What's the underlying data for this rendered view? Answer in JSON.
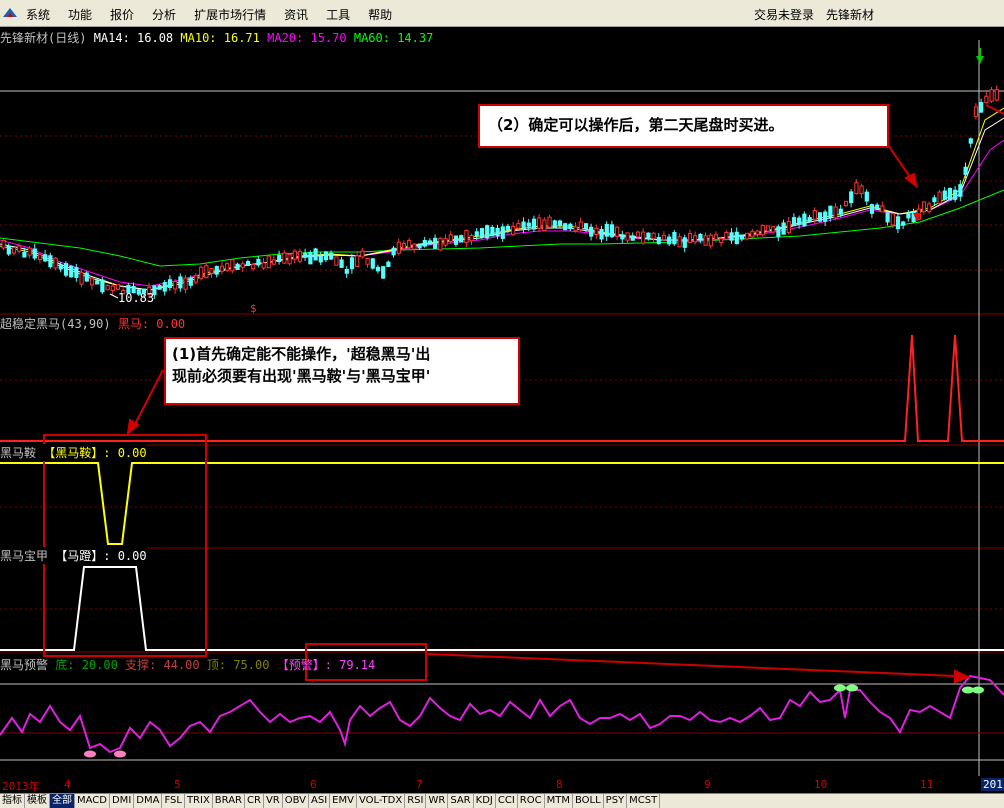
{
  "menu": {
    "items": [
      "系统",
      "功能",
      "报价",
      "分析",
      "扩展市场行情",
      "资讯",
      "工具",
      "帮助"
    ],
    "login_status": "交易未登录",
    "stock_name_right": "先锋新材"
  },
  "main_panel": {
    "title": "先锋新材(日线)",
    "ma14": "MA14: 16.08",
    "ma10": "MA10: 16.71",
    "ma20": "MA20: 15.70",
    "ma60": "MA60: 14.37",
    "low_label": "10.83",
    "marker_s": "$",
    "colors": {
      "ma14": "#ffffff",
      "ma10": "#ffff00",
      "ma20": "#ff00ff",
      "ma60": "#00ff00",
      "up": "#ff3232",
      "down": "#54ffff"
    }
  },
  "panel1": {
    "title": "超稳定黑马(43,90)",
    "value": "黑马: 0.00"
  },
  "panel2": {
    "title": "黑马鞍",
    "value_label": "【黑马鞍】: 0.00"
  },
  "panel3": {
    "title": "黑马宝甲",
    "value_label": "【马蹬】: 0.00"
  },
  "panel4": {
    "title": "黑马预警",
    "di": "底: 20.00",
    "zhicheng": "支撑: 44.00",
    "ding": "顶: 75.00",
    "yujing": "【预警】: 79.14"
  },
  "callouts": {
    "c1_line1": "(1)首先确定能不能操作，'超稳黑马'出",
    "c1_line2": "现前必须要有出现'黑马鞍'与'黑马宝甲'",
    "c2": "（2）确定可以操作后，第二天尾盘时买进。"
  },
  "xaxis": {
    "labels": [
      "2013年",
      "4",
      "5",
      "6",
      "7",
      "8",
      "9",
      "10",
      "11",
      "201"
    ]
  },
  "bottom_tabs": [
    "指标",
    "模板",
    "全部",
    "MACD",
    "DMI",
    "DMA",
    "FSL",
    "TRIX",
    "BRAR",
    "CR",
    "VR",
    "OBV",
    "ASI",
    "EMV",
    "VOL-TDX",
    "RSI",
    "WR",
    "SAR",
    "KDJ",
    "CCI",
    "ROC",
    "MTM",
    "BOLL",
    "PSY",
    "MCST"
  ]
}
